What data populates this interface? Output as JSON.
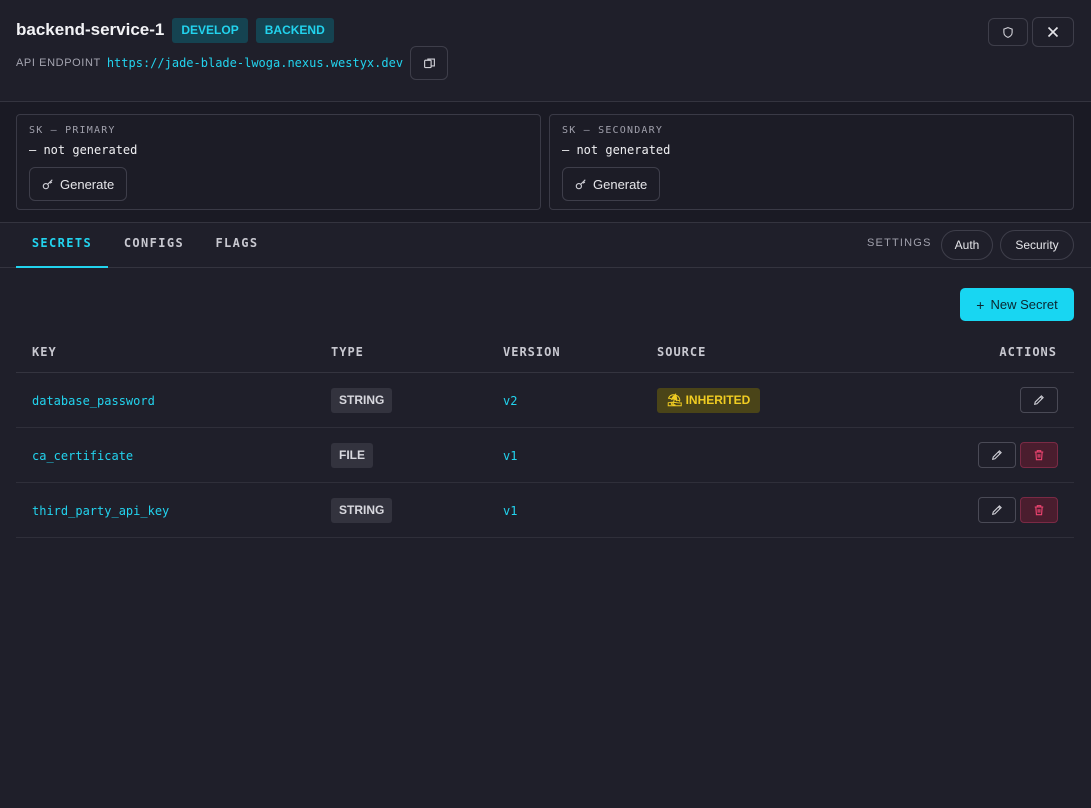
{
  "header": {
    "title": "backend-service-1",
    "tags": [
      "DEVELOP",
      "BACKEND"
    ],
    "endpoint_label": "API ENDPOINT",
    "endpoint_url": "https://jade-blade-lwoga.nexus.westyx.dev"
  },
  "keys": {
    "primary": {
      "label": "SK — PRIMARY",
      "status": "— not generated",
      "button": "Generate"
    },
    "secondary": {
      "label": "SK — SECONDARY",
      "status": "— not generated",
      "button": "Generate"
    }
  },
  "tabs": {
    "items": [
      {
        "label": "SECRETS",
        "active": true
      },
      {
        "label": "CONFIGS",
        "active": false
      },
      {
        "label": "FLAGS",
        "active": false
      }
    ],
    "settings_label": "SETTINGS",
    "auth": "Auth",
    "security": "Security"
  },
  "actions": {
    "new_secret": "New Secret"
  },
  "table": {
    "columns": [
      "KEY",
      "TYPE",
      "VERSION",
      "SOURCE",
      "ACTIONS"
    ],
    "rows": [
      {
        "key": "database_password",
        "type": "STRING",
        "version": "v2",
        "source": "INHERITED",
        "deletable": false
      },
      {
        "key": "ca_certificate",
        "type": "FILE",
        "version": "v1",
        "source": "",
        "deletable": true
      },
      {
        "key": "third_party_api_key",
        "type": "STRING",
        "version": "v1",
        "source": "",
        "deletable": true
      }
    ]
  },
  "colors": {
    "accent": "#22d3ee",
    "background": "#1f1f2a",
    "inherited": "#f0cc22",
    "danger": "#ef4470"
  },
  "icons": [
    "shield-icon",
    "close-icon",
    "copy-icon",
    "key-icon",
    "plus-icon",
    "pencil-icon",
    "trash-icon",
    "umbrella-icon"
  ]
}
